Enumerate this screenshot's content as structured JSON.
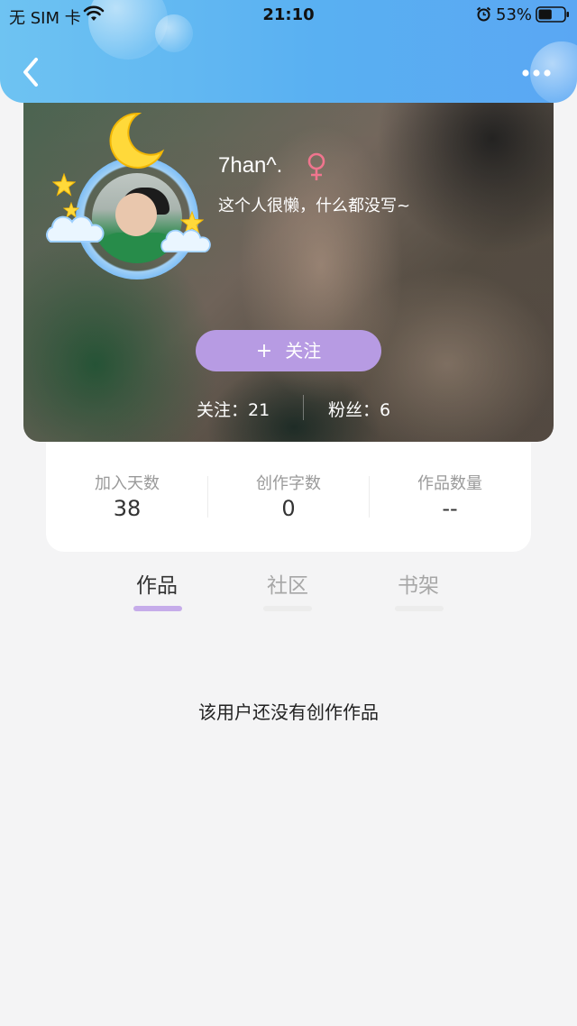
{
  "status_bar": {
    "carrier": "无 SIM 卡",
    "time": "21:10",
    "battery_percent": "53%",
    "battery_level": 0.53
  },
  "nav": {
    "back_icon": "chevron-left-icon",
    "more_icon": "more-dots-icon"
  },
  "profile": {
    "username": "7han^.",
    "gender_icon": "female-icon",
    "gender_color": "#f0758e",
    "bio": "这个人很懒，什么都没写~",
    "follow_plus": "+",
    "follow_label": "关注",
    "following": "关注：21",
    "fans": "粉丝：6"
  },
  "stats": [
    {
      "label": "加入天数",
      "value": "38"
    },
    {
      "label": "创作字数",
      "value": "0"
    },
    {
      "label": "作品数量",
      "value": "--"
    }
  ],
  "tabs": [
    {
      "label": "作品",
      "active": true
    },
    {
      "label": "社区",
      "active": false
    },
    {
      "label": "书架",
      "active": false
    }
  ],
  "empty_state": "该用户还没有创作作品",
  "colors": {
    "header_gradient_start": "#6ec3f2",
    "header_gradient_end": "#5aa7f3",
    "accent_purple": "#b79be3",
    "tab_indicator": "#c6acea"
  }
}
